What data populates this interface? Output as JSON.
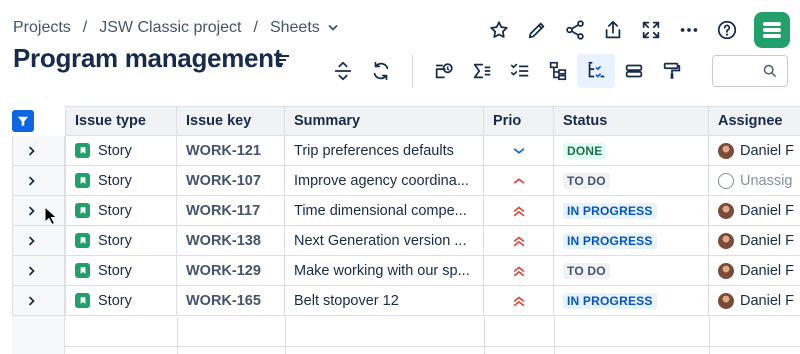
{
  "breadcrumb": {
    "items": [
      "Projects",
      "JSW Classic project",
      "Sheets"
    ],
    "separator": "/"
  },
  "page": {
    "title": "Program management"
  },
  "top_actions": [
    "star-icon",
    "pencil-icon",
    "share-icon",
    "export-icon",
    "fullscreen-icon",
    "more-icon",
    "help-icon",
    "app-logo"
  ],
  "toolbar": {
    "tools": [
      "expand-collapse-icon",
      "refresh-icon",
      "add-field-icon",
      "sum-icon",
      "checklist-icon",
      "hierarchy-icon",
      "hierarchy-filter-icon",
      "card-layout-icon",
      "paint-roller-icon"
    ],
    "active_tool": "hierarchy-filter-icon"
  },
  "search": {
    "placeholder": "",
    "value": ""
  },
  "table": {
    "columns": [
      "Issue type",
      "Issue key",
      "Summary",
      "Prio",
      "Status",
      "Assignee"
    ],
    "rows": [
      {
        "type": "Story",
        "key": "WORK-121",
        "summary": "Trip preferences defaults",
        "prio": "low",
        "status": "DONE",
        "status_kind": "done",
        "assignee": "Daniel F",
        "assigned": true
      },
      {
        "type": "Story",
        "key": "WORK-107",
        "summary": "Improve agency coordina...",
        "prio": "medium-high",
        "status": "TO DO",
        "status_kind": "todo",
        "assignee": "Unassig",
        "assigned": false
      },
      {
        "type": "Story",
        "key": "WORK-117",
        "summary": "Time dimensional compe...",
        "prio": "high",
        "status": "IN PROGRESS",
        "status_kind": "prog",
        "assignee": "Daniel F",
        "assigned": true
      },
      {
        "type": "Story",
        "key": "WORK-138",
        "summary": "Next Generation version ...",
        "prio": "high",
        "status": "IN PROGRESS",
        "status_kind": "prog",
        "assignee": "Daniel F",
        "assigned": true
      },
      {
        "type": "Story",
        "key": "WORK-129",
        "summary": "Make working with our sp...",
        "prio": "high",
        "status": "TO DO",
        "status_kind": "todo",
        "assignee": "Daniel F",
        "assigned": true
      },
      {
        "type": "Story",
        "key": "WORK-165",
        "summary": "Belt stopover 12",
        "prio": "high",
        "status": "IN PROGRESS",
        "status_kind": "prog",
        "assignee": "Daniel F",
        "assigned": true
      }
    ]
  },
  "colors": {
    "brand_green": "#22a06b",
    "accent_blue": "#0c66e4",
    "prio_low": "#0c66e4",
    "prio_high": "#e2483d",
    "prio_medium_high": "#e2483d"
  }
}
